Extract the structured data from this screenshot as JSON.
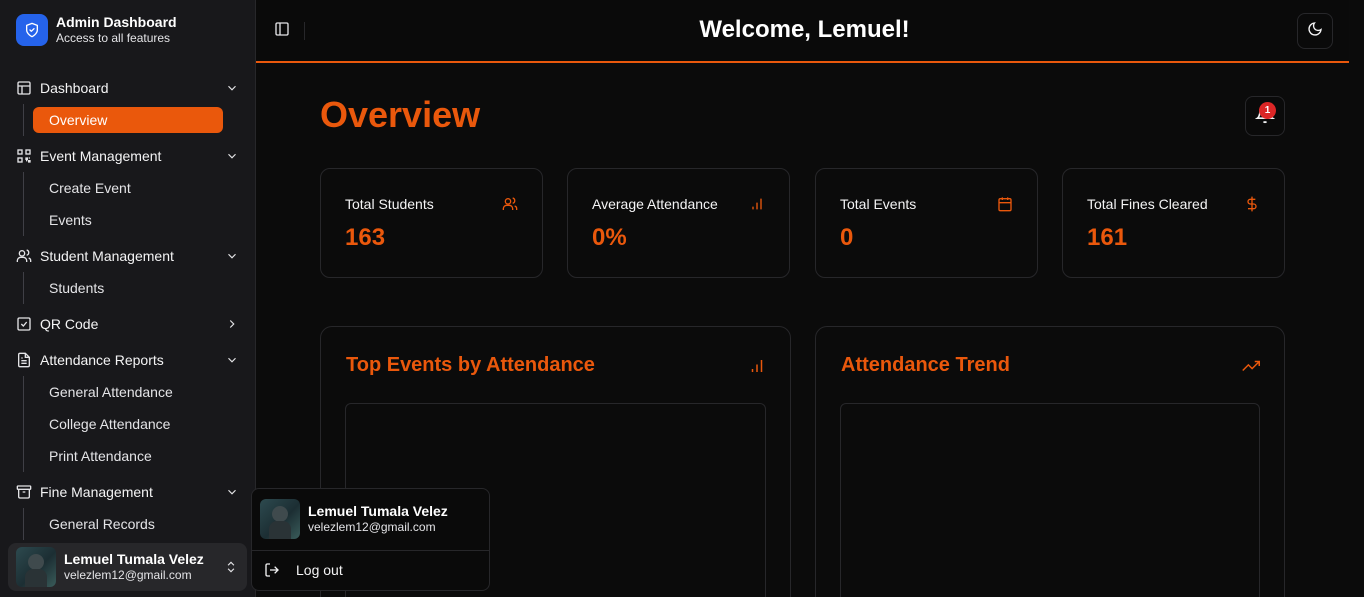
{
  "app": {
    "brand_title": "Admin Dashboard",
    "brand_subtitle": "Access to all features"
  },
  "sidebar": {
    "groups": [
      {
        "label": "Dashboard",
        "icon": "layout-icon",
        "expanded": true,
        "items": [
          {
            "label": "Overview",
            "active": true
          }
        ]
      },
      {
        "label": "Event Management",
        "icon": "qr-grid-icon",
        "expanded": true,
        "items": [
          {
            "label": "Create Event"
          },
          {
            "label": "Events"
          }
        ]
      },
      {
        "label": "Student Management",
        "icon": "users-icon",
        "expanded": true,
        "items": [
          {
            "label": "Students"
          }
        ]
      },
      {
        "label": "QR Code",
        "icon": "checkbox-icon",
        "expanded": false,
        "items": []
      },
      {
        "label": "Attendance Reports",
        "icon": "file-text-icon",
        "expanded": true,
        "items": [
          {
            "label": "General Attendance"
          },
          {
            "label": "College Attendance"
          },
          {
            "label": "Print Attendance"
          }
        ]
      },
      {
        "label": "Fine Management",
        "icon": "archive-icon",
        "expanded": true,
        "items": [
          {
            "label": "General Records"
          }
        ]
      }
    ]
  },
  "user": {
    "name": "Lemuel Tumala Velez",
    "email": "velezlem12@gmail.com"
  },
  "header": {
    "welcome": "Welcome, Lemuel!"
  },
  "main": {
    "title": "Overview",
    "notification_count": "1",
    "stats": [
      {
        "label": "Total Students",
        "value": "163",
        "icon": "users-icon"
      },
      {
        "label": "Average Attendance",
        "value": "0%",
        "icon": "bar-chart-icon"
      },
      {
        "label": "Total Events",
        "value": "0",
        "icon": "calendar-icon"
      },
      {
        "label": "Total Fines Cleared",
        "value": "161",
        "icon": "dollar-icon"
      }
    ],
    "panels": [
      {
        "title": "Top Events by Attendance",
        "icon": "bar-chart-icon"
      },
      {
        "title": "Attendance Trend",
        "icon": "trending-up-icon"
      }
    ]
  },
  "popup": {
    "logout_label": "Log out"
  },
  "colors": {
    "accent": "#ea580c",
    "brand": "#2563eb",
    "badge": "#dc2626",
    "sidebar_bg": "#18181b",
    "page_bg": "#0b0b0b"
  }
}
